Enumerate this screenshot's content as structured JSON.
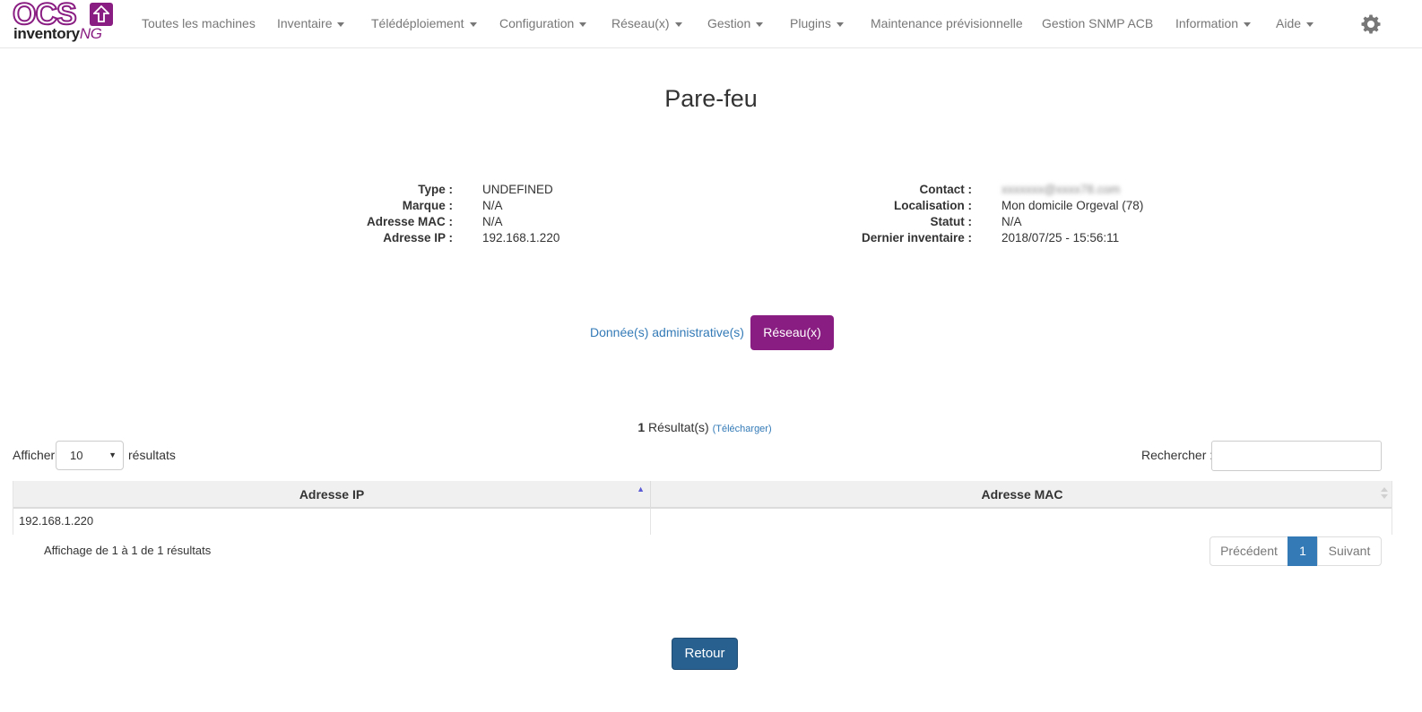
{
  "brand": {
    "logo_top": "OCS",
    "logo_bottom": "inventory",
    "logo_suffix": "NG",
    "color": "#8a1d82"
  },
  "nav": {
    "items": [
      {
        "label": "Toutes les machines",
        "dropdown": false
      },
      {
        "label": "Inventaire",
        "dropdown": true
      },
      {
        "label": "Télédéploiement",
        "dropdown": true
      },
      {
        "label": "Configuration",
        "dropdown": true
      },
      {
        "label": "Réseau(x)",
        "dropdown": true
      },
      {
        "label": "Gestion",
        "dropdown": true
      },
      {
        "label": "Plugins",
        "dropdown": true
      },
      {
        "label": "Maintenance prévisionnelle",
        "dropdown": false
      },
      {
        "label": "Gestion SNMP ACB",
        "dropdown": false
      },
      {
        "label": "Information",
        "dropdown": true
      },
      {
        "label": "Aide",
        "dropdown": true
      }
    ],
    "settings_icon": "gear-icon"
  },
  "page": {
    "title": "Pare-feu"
  },
  "details": {
    "left": [
      {
        "label": "Type :",
        "value": "UNDEFINED"
      },
      {
        "label": "Marque :",
        "value": "N/A"
      },
      {
        "label": "Adresse MAC :",
        "value": "N/A"
      },
      {
        "label": "Adresse IP :",
        "value": "192.168.1.220"
      }
    ],
    "right": [
      {
        "label": "Contact :",
        "value": "xxxxxxx@xxxx78.com",
        "blurred": true
      },
      {
        "label": "Localisation :",
        "value": "Mon domicile Orgeval (78)"
      },
      {
        "label": "Statut :",
        "value": "N/A"
      },
      {
        "label": "Dernier inventaire :",
        "value": "2018/07/25 - 15:56:11"
      }
    ]
  },
  "tabs": {
    "admin_label": "Donnée(s) administrative(s)",
    "network_label": "Réseau(x)",
    "active_color": "#8a1d82"
  },
  "results": {
    "count": "1",
    "label": "Résultat(s)",
    "download_label": "(Télécharger)"
  },
  "table_controls": {
    "show_prefix": "Afficher",
    "show_value": "10",
    "show_suffix": "résultats",
    "search_label": "Rechercher :",
    "search_value": ""
  },
  "table": {
    "columns": [
      "Adresse IP",
      "Adresse MAC"
    ],
    "rows": [
      [
        "192.168.1.220",
        ""
      ]
    ],
    "footer": "Affichage de 1 à 1 de 1 résultats"
  },
  "pagination": {
    "prev": "Précédent",
    "current": "1",
    "next": "Suivant",
    "active_color": "#337ab7"
  },
  "back_button": "Retour"
}
